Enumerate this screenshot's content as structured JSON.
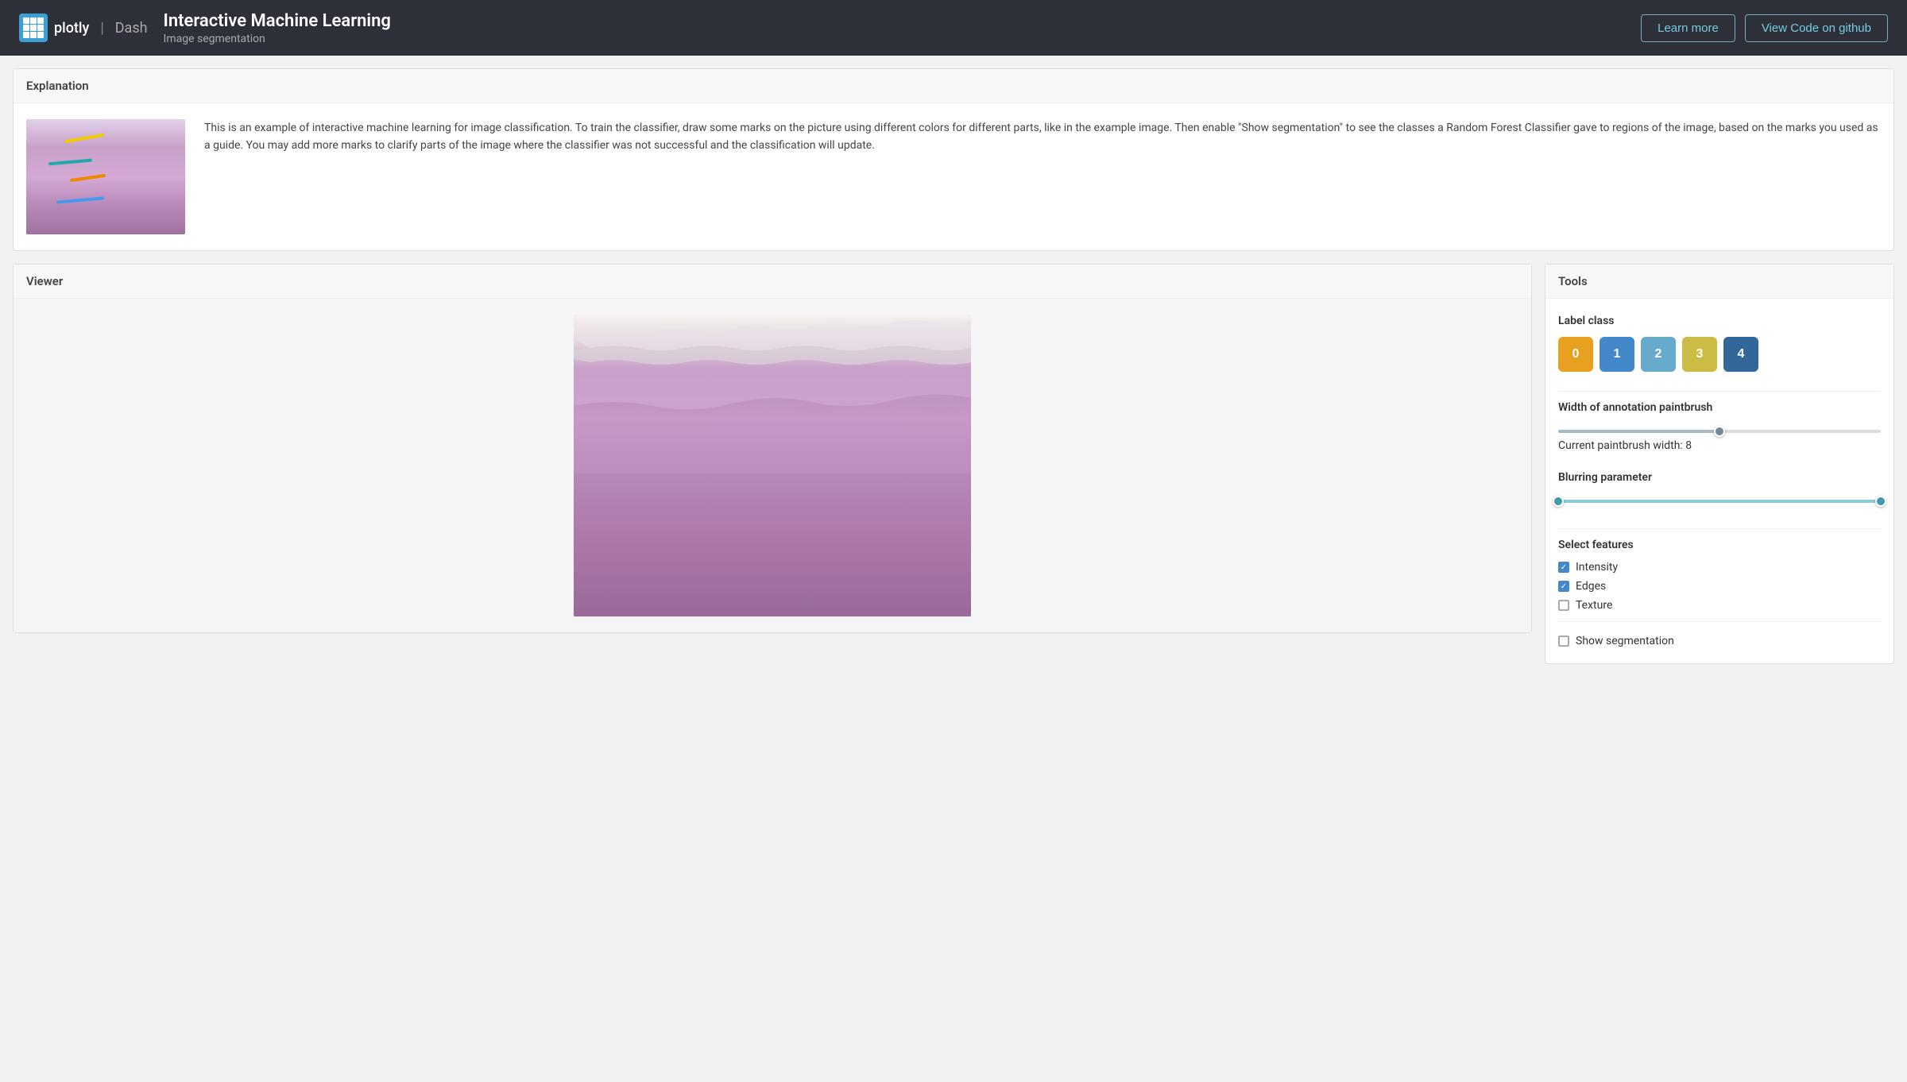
{
  "header": {
    "logo_text": "plotly",
    "separator": "|",
    "dash_text": "Dash",
    "app_title": "Interactive Machine Learning",
    "app_subtitle": "Image segmentation",
    "btn_learn_more": "Learn more",
    "btn_view_code": "View Code on github"
  },
  "explanation": {
    "section_title": "Explanation",
    "description": "This is an example of interactive machine learning for image classification. To train the classifier, draw some marks on the picture using different colors for different parts, like in the example image. Then enable \"Show segmentation\" to see the classes a Random Forest Classifier gave to regions of the image, based on the marks you used as a guide. You may add more marks to clarify parts of the image where the classifier was not successful and the classification will update."
  },
  "viewer": {
    "section_title": "Viewer"
  },
  "tools": {
    "section_title": "Tools",
    "label_class_title": "Label class",
    "label_buttons": [
      {
        "value": "0",
        "color": "#e8a020"
      },
      {
        "value": "1",
        "color": "#4488cc"
      },
      {
        "value": "2",
        "color": "#66aacc"
      },
      {
        "value": "3",
        "color": "#ccbb44"
      },
      {
        "value": "4",
        "color": "#336699"
      }
    ],
    "paintbrush_width_label": "Width of annotation paintbrush",
    "current_paintbrush_label": "Current paintbrush width: 8",
    "blurring_label": "Blurring parameter",
    "features_label": "Select features",
    "features": [
      {
        "name": "Intensity",
        "checked": true
      },
      {
        "name": "Edges",
        "checked": true
      },
      {
        "name": "Texture",
        "checked": false
      }
    ],
    "show_segmentation_label": "Show segmentation"
  }
}
